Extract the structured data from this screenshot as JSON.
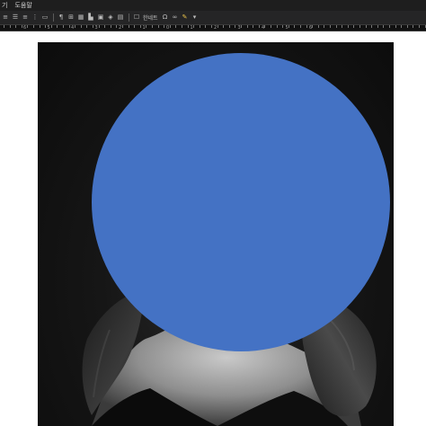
{
  "menubar": {
    "items": [
      "기",
      "도움말"
    ]
  },
  "toolbar": {
    "shape_label": "한네트",
    "icons": [
      "align-left-icon",
      "align-center-icon",
      "align-right-icon",
      "list-icon",
      "indent-icon",
      "paragraph-icon",
      "table-icon",
      "chart-icon",
      "shape-icon",
      "char-map-icon",
      "hyperlink-icon",
      "highlight-icon",
      "dropdown-icon"
    ]
  },
  "ruler": {
    "labels": [
      "6",
      "5",
      "4",
      "3",
      "2",
      "1",
      "0",
      "1",
      "2",
      "3",
      "4",
      "5",
      "6"
    ]
  },
  "document": {
    "redaction_color": "#4472C4"
  }
}
